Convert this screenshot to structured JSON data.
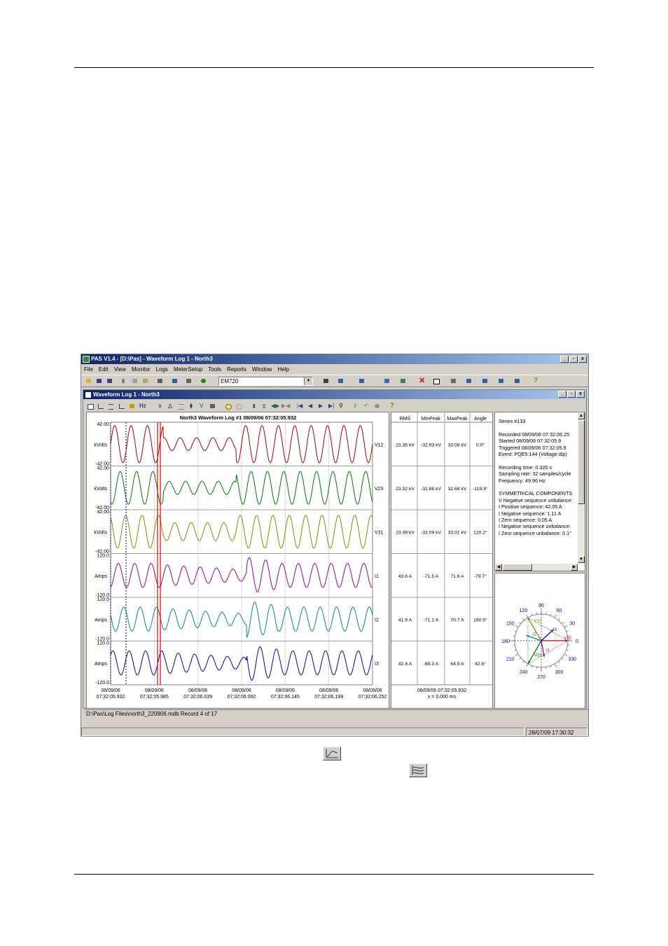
{
  "app": {
    "title": "PAS V1.4 - [D:\\Pas] - Waveform Log 1 - North3",
    "menu": [
      "File",
      "Edit",
      "View",
      "Monitor",
      "Logs",
      "MeterSetup",
      "Tools",
      "Reports",
      "Window",
      "Help"
    ],
    "device_combo": "EM720",
    "status_datetime": "28/07/09 17:30:32"
  },
  "child": {
    "title": "Waveform Log 1 - North3",
    "status_path": "D:\\Pas\\Log Files\\north3_220906.mdb   Record 4 of 17"
  },
  "plot": {
    "title": "North3  Waveform Log #1   08/09/06  07:32:05.932",
    "channels": [
      {
        "name": "V12",
        "unit": "kVolts",
        "top": "42.00",
        "bottom": "-42.00",
        "color": "#b00000"
      },
      {
        "name": "V23",
        "unit": "kVolts",
        "top": "42.00",
        "bottom": "-42.00",
        "color": "#007a00"
      },
      {
        "name": "V31",
        "unit": "kVolts",
        "top": "42.00",
        "bottom": "-42.00",
        "color": "#8a8a00"
      },
      {
        "name": "I1",
        "unit": "Amps",
        "top": "120.0",
        "bottom": "-120.0",
        "color": "#9a009a"
      },
      {
        "name": "I2",
        "unit": "Amps",
        "top": "120.0",
        "bottom": "-120.0",
        "color": "#008a8a"
      },
      {
        "name": "I3",
        "unit": "Amps",
        "top": "120.0",
        "bottom": "-120.0",
        "color": "#0000c0"
      }
    ],
    "x_ticks": [
      {
        "date": "08/09/06",
        "time": "07:32:05.932"
      },
      {
        "date": "08/09/06",
        "time": "07:32:05.985"
      },
      {
        "date": "08/09/06",
        "time": "07:32:06.039"
      },
      {
        "date": "08/09/06",
        "time": "07:32:06.092"
      },
      {
        "date": "08/09/06",
        "time": "07:32:06.145"
      },
      {
        "date": "08/09/06",
        "time": "07:32:06.199"
      },
      {
        "date": "08/09/06",
        "time": "07:32:06.252"
      }
    ]
  },
  "table": {
    "headers": [
      "RMS",
      "MinPeak",
      "MaxPeak",
      "Angle"
    ],
    "rows": [
      [
        "23.35 kV",
        "-32.93 kV",
        "33.08 kV",
        "0.0°"
      ],
      [
        "23.32 kV",
        "-32.88 kV",
        "32.68 kV",
        "-119.8°"
      ],
      [
        "23.39 kV",
        "-33.09 kV",
        "33.01 kV",
        "120.2°"
      ],
      [
        "43.6 A",
        "-71.5 A",
        "71.6 A",
        "-79.7°"
      ],
      [
        "41.9 A",
        "-71.1 A",
        "70.7 A",
        "160.5°"
      ],
      [
        "42.8 A",
        "-69.3 A",
        "64.9 A",
        "42.6°"
      ]
    ],
    "footer_time": "08/09/06  07:32:05.932",
    "footer_x": "x = 0.000 ms"
  },
  "info": {
    "lines": [
      "Series #133",
      "",
      "Recorded 08/09/06  07:32:06.25",
      "Started    08/09/06  07:32:05.9",
      "Triggered 08/09/06  07:32:05.9",
      "Event: PQE5:144 (Voltage dip)",
      "",
      "Recording time: 0.320 s",
      "Sampling rate: 32 samples/cycle",
      "Frequency: 49.96 Hz",
      "",
      "SYMMETRICAL COMPONENTS",
      "V Negative sequence unbalance:",
      "I Positive sequence: 42.05 A",
      "I Negative sequence: 1.11 A",
      "I Zero sequence: 0.05 A",
      "I Negative sequence unbalance:",
      "I Zero sequence unbalance: 0.1°"
    ]
  },
  "phasor": {
    "labels": [
      "90",
      "60",
      "30",
      "0",
      "330",
      "300",
      "270",
      "240",
      "210",
      "180",
      "150",
      "120"
    ],
    "vectors": [
      {
        "name": "V12",
        "angle": 0,
        "mag": 1.0,
        "color": "#b00000"
      },
      {
        "name": "V23",
        "angle": -119.8,
        "mag": 1.0,
        "color": "#007a00"
      },
      {
        "name": "V31",
        "angle": 120.2,
        "mag": 1.0,
        "color": "#8a8a00"
      },
      {
        "name": "I1",
        "angle": -79.7,
        "mag": 0.62,
        "color": "#9a009a"
      },
      {
        "name": "I2",
        "angle": 160.5,
        "mag": 0.6,
        "color": "#008a8a"
      },
      {
        "name": "I3",
        "angle": 42.6,
        "mag": 0.61,
        "color": "#0000c0"
      }
    ]
  }
}
